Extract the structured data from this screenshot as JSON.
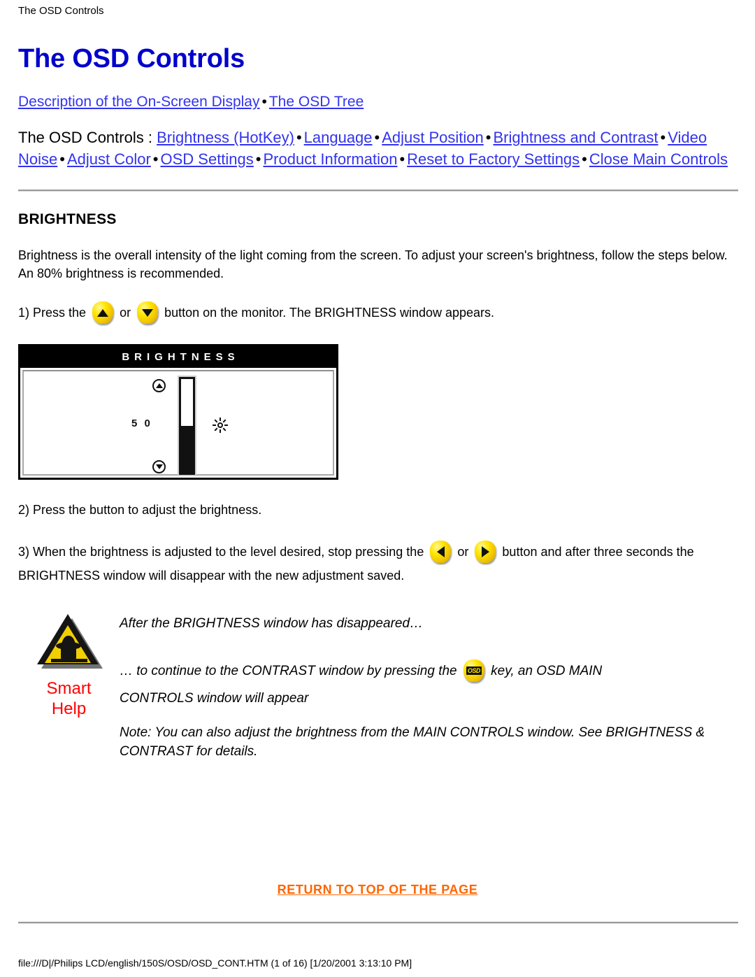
{
  "browser": {
    "header_title": "The OSD Controls"
  },
  "document": {
    "title": "The OSD Controls",
    "nav_top": {
      "link_description": "Description of the On-Screen Display",
      "bullet": "•",
      "link_osd_tree": "The OSD Tree"
    },
    "nav_controls": {
      "prefix": "The OSD Controls : ",
      "items": [
        "Brightness (HotKey)",
        "Language",
        "Adjust Position",
        "Brightness and Contrast",
        "Video Noise",
        "Adjust Color",
        "OSD Settings",
        "Product Information",
        "Reset to Factory Settings",
        "Close Main Controls"
      ],
      "separator": "•"
    },
    "section": {
      "heading": "BRIGHTNESS",
      "intro": "Brightness is the overall intensity of the light coming from the screen. To adjust your screen's brightness, follow the steps below. An 80% brightness is recommended.",
      "step1_a": "1) Press the",
      "step1_or": "or",
      "step1_b": "button on the monitor. The BRIGHTNESS window appears.",
      "step2": "2) Press the button to adjust the brightness.",
      "step3_a": "3) When the brightness is adjusted to the level desired, stop pressing the",
      "step3_or": "or",
      "step3_b": "button and after",
      "step3_c": "three seconds the BRIGHTNESS window will disappear with the new adjustment saved."
    },
    "osd_window": {
      "title": "BRIGHTNESS",
      "value": "5 0",
      "fill_percent": 50,
      "up_icon": "circle-arrow-up-icon",
      "down_icon": "circle-arrow-down-icon",
      "function_icon": "brightness-sun-icon"
    },
    "smart_help": {
      "icon": "warning-triangle-icon",
      "label_line1": "Smart",
      "label_line2": "Help",
      "label_color": "#FF0000",
      "para1": "After the BRIGHTNESS window has disappeared…",
      "para2_a": "… to continue to the CONTRAST window by pressing the",
      "osd_key_label": "OSD",
      "para2_b": "key, an OSD MAIN",
      "para3": "CONTROLS window will appear",
      "para4": "Note: You can also adjust the brightness from the MAIN CONTROLS window. See BRIGHTNESS & CONTRAST for details."
    },
    "footer": {
      "return_link": "RETURN TO TOP OF THE PAGE",
      "file_path": "file:///D|/Philips LCD/english/150S/OSD/OSD_CONT.HTM (1 of 16) [1/20/2001 3:13:10 PM]"
    }
  },
  "colors": {
    "title_blue": "#0000CC",
    "link_blue": "#3333EE",
    "return_orange": "#FF6600",
    "smart_help_red": "#FF0000",
    "button_yellow": "#FFE500"
  }
}
